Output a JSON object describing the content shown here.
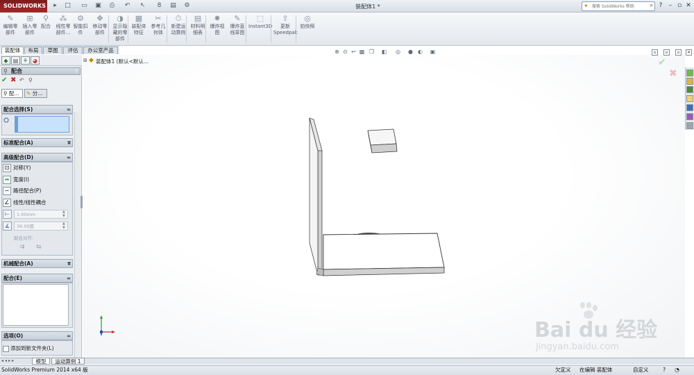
{
  "app": {
    "logo_text": "SOLIDWORKS",
    "document_title": "装配体1 *",
    "help_search_placeholder": "搜索 SolidWorks 帮助"
  },
  "quick_access": [
    {
      "name": "new-icon",
      "glyph": "□"
    },
    {
      "name": "open-icon",
      "glyph": "📁"
    },
    {
      "name": "save-icon",
      "glyph": "💾"
    },
    {
      "name": "print-icon",
      "glyph": "⎙"
    },
    {
      "name": "undo-icon",
      "glyph": "↶"
    },
    {
      "name": "select-icon",
      "glyph": "↖"
    },
    {
      "name": "rebuild-icon",
      "glyph": "8"
    },
    {
      "name": "file-properties-icon",
      "glyph": "▤"
    },
    {
      "name": "options-icon",
      "glyph": "⚙"
    }
  ],
  "ribbon": [
    {
      "label": "编辑零\n部件",
      "icon": "edit-component-icon"
    },
    {
      "label": "插入零\n部件",
      "icon": "insert-component-icon"
    },
    {
      "label": "配合",
      "icon": "mate-icon"
    },
    {
      "label": "线性零\n部件...",
      "icon": "linear-pattern-icon"
    },
    {
      "label": "智能扣\n件",
      "icon": "smart-fastener-icon"
    },
    {
      "label": "移动零\n部件",
      "icon": "move-component-icon"
    },
    {
      "label": "显示隐\n藏的零\n部件",
      "icon": "show-hidden-icon"
    },
    {
      "label": "装配体\n特征",
      "icon": "assembly-feature-icon"
    },
    {
      "label": "参考几\n何体",
      "icon": "reference-geometry-icon"
    },
    {
      "label": "新建运\n动算例",
      "icon": "motion-study-icon"
    },
    {
      "label": "材料明\n细表",
      "icon": "bom-icon"
    },
    {
      "label": "爆炸视\n图",
      "icon": "exploded-view-icon"
    },
    {
      "label": "爆炸直\n线草图",
      "icon": "explode-line-icon"
    },
    {
      "label": "Instant3D",
      "icon": "instant3d-icon"
    },
    {
      "label": "更新\nSpeedpak",
      "icon": "speedpak-icon"
    },
    {
      "label": "拍快照",
      "icon": "snapshot-icon"
    }
  ],
  "command_tabs": [
    "装配体",
    "布局",
    "草图",
    "评估",
    "办公室产品"
  ],
  "feature_tree_root": "装配体1  (默认<默认...",
  "mate_panel": {
    "title": "配合",
    "help": "?",
    "tab1": "配...",
    "tab2": "分...",
    "sections": {
      "mate_selections": "配合选择(S)",
      "standard_mates": "标准配合(A)",
      "advanced_mates": "高级配合(D)",
      "mechanical_mates": "机械配合(A)",
      "mates": "配合(E)",
      "options": "选项(O)"
    },
    "advanced_items": [
      "对称(Y)",
      "宽度(I)",
      "路径配合(P)",
      "线性/线性耦合"
    ],
    "distance_value": "1.00mm",
    "angle_value": "30.00度",
    "mate_alignment": "配合对齐:",
    "option_checkbox": "添加到新文件夹(L)"
  },
  "bottom_tabs": [
    "模型",
    "运动算例 1"
  ],
  "status": {
    "product": "SolidWorks Premium 2014 x64 版",
    "under_defined": "欠定义",
    "editing": "在编辑 装配体",
    "custom": "自定义"
  },
  "watermark": {
    "brand": "Bai du 经验",
    "url": "jingyan.baidu.com"
  }
}
